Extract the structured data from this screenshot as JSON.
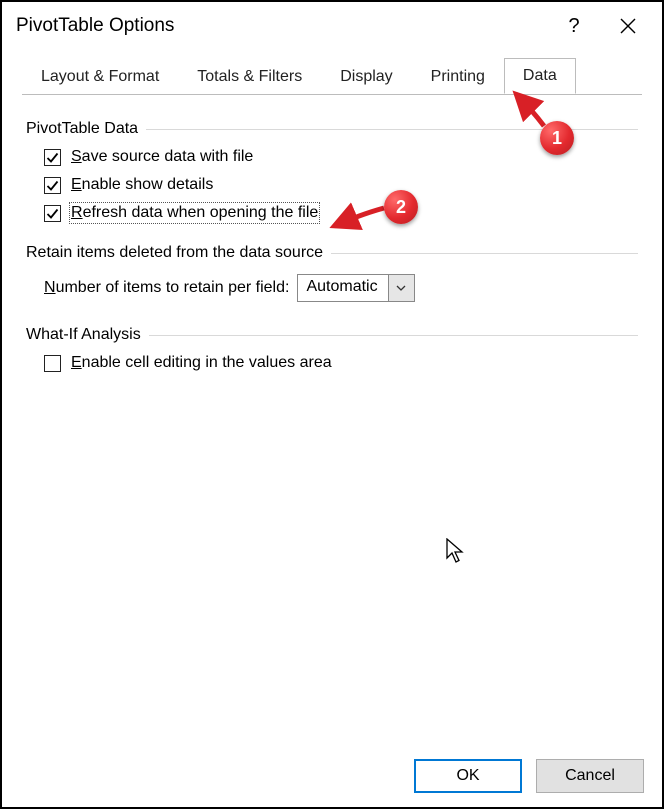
{
  "title": "PivotTable Options",
  "tabs": {
    "layout": "Layout & Format",
    "totals": "Totals & Filters",
    "display": "Display",
    "printing": "Printing",
    "data": "Data"
  },
  "activeTab": "data",
  "sections": {
    "pivot_data": "PivotTable Data",
    "retain": "Retain items deleted from the data source",
    "whatif": "What-If Analysis"
  },
  "checks": {
    "save_source_pre": "S",
    "save_source_post": "ave source data with file",
    "enable_show_pre": "E",
    "enable_show_post": "nable show details",
    "refresh_pre": "R",
    "refresh_post": "efresh data when opening the file",
    "enable_cell_pre": "E",
    "enable_cell_post": "nable cell editing in the values area"
  },
  "field": {
    "label_pre": "N",
    "label_post": "umber of items to retain per field:",
    "value": "Automatic"
  },
  "buttons": {
    "ok": "OK",
    "cancel": "Cancel"
  },
  "help_symbol": "?",
  "callouts": {
    "one": "1",
    "two": "2"
  }
}
